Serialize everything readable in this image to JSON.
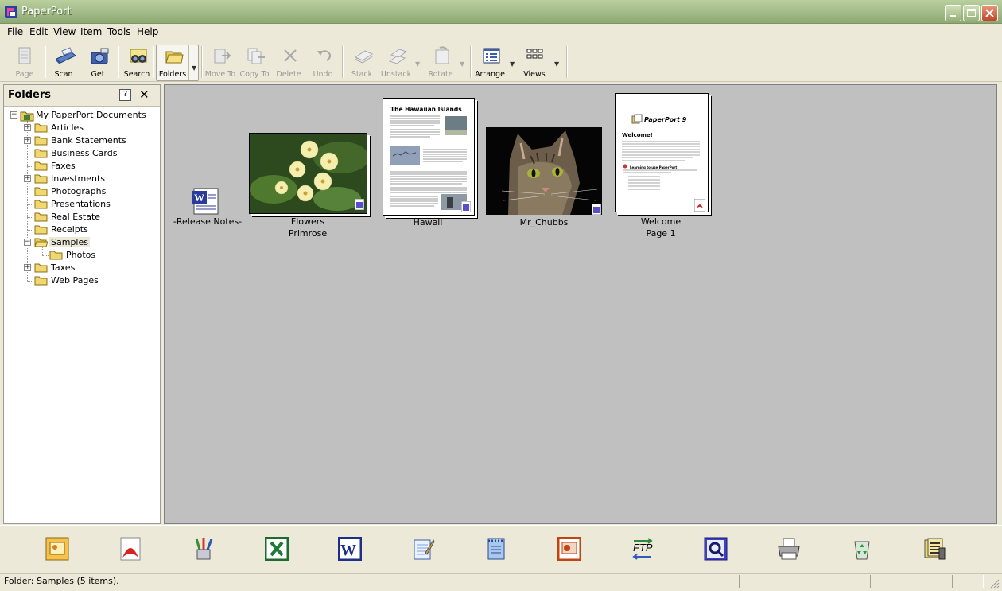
{
  "window": {
    "title": "PaperPort"
  },
  "menu": [
    "File",
    "Edit",
    "View",
    "Item",
    "Tools",
    "Help"
  ],
  "toolbar": {
    "page": "Page",
    "scan": "Scan",
    "get": "Get",
    "search": "Search",
    "folders": "Folders",
    "move_to": "Move To",
    "copy_to": "Copy To",
    "delete": "Delete",
    "undo": "Undo",
    "stack": "Stack",
    "unstack": "Unstack",
    "rotate": "Rotate",
    "arrange": "Arrange",
    "views": "Views"
  },
  "folders_pane": {
    "title": "Folders",
    "root": "My PaperPort Documents",
    "items": [
      "Articles",
      "Bank Statements",
      "Business Cards",
      "Faxes",
      "Investments",
      "Photographs",
      "Presentations",
      "Real Estate",
      "Receipts",
      "Samples",
      "Photos",
      "Taxes",
      "Web Pages"
    ]
  },
  "items": [
    {
      "caption": "-Release Notes-",
      "caption2": ""
    },
    {
      "caption": "Flowers",
      "caption2": "Primrose"
    },
    {
      "caption": "Hawaii",
      "caption2": ""
    },
    {
      "caption": "Mr_Chubbs",
      "caption2": ""
    },
    {
      "caption": "Welcome",
      "caption2": "Page 1"
    }
  ],
  "hawaii_doc": {
    "heading": "The Hawaiian Islands"
  },
  "welcome_doc": {
    "heading": "Welcome!",
    "subheading": "Learning to use PaperPort",
    "logo": "PaperPort 9"
  },
  "sendto": {
    "ftp_label": "FTP"
  },
  "status": {
    "text": "Folder: Samples (5 items)."
  }
}
